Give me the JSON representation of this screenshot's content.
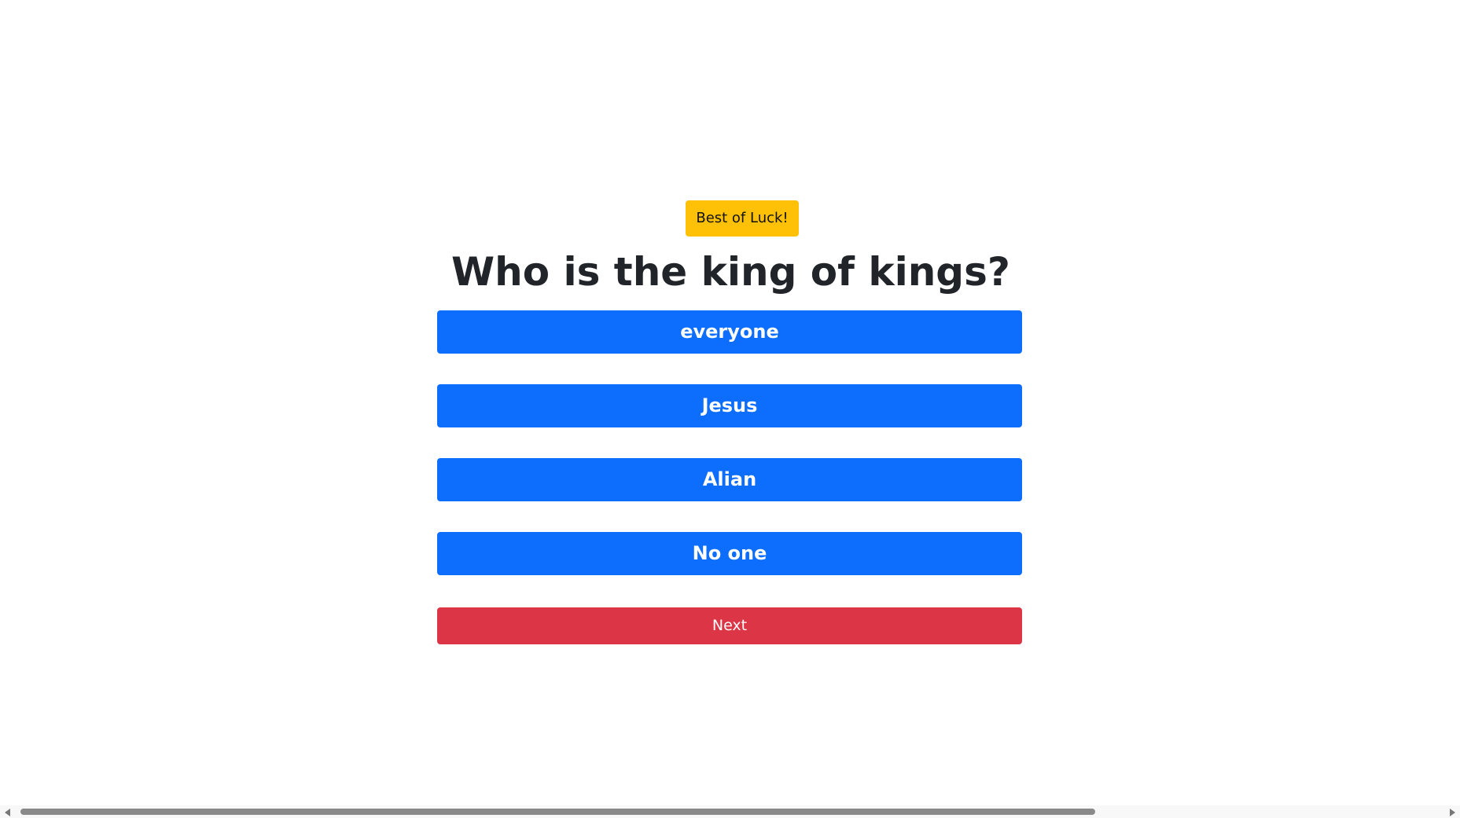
{
  "quiz": {
    "badge": "Best of Luck!",
    "question": "Who is the king of kings?",
    "answers": [
      {
        "label": "everyone"
      },
      {
        "label": "Jesus"
      },
      {
        "label": "Alian"
      },
      {
        "label": "No one"
      }
    ],
    "next_label": "Next"
  },
  "colors": {
    "answer_button": "#0d6efd",
    "next_button": "#dc3545",
    "badge": "#ffc107",
    "question_text": "#212529"
  },
  "scrollbar": {
    "left_icon": "scroll-left-arrow",
    "right_icon": "scroll-right-arrow"
  }
}
